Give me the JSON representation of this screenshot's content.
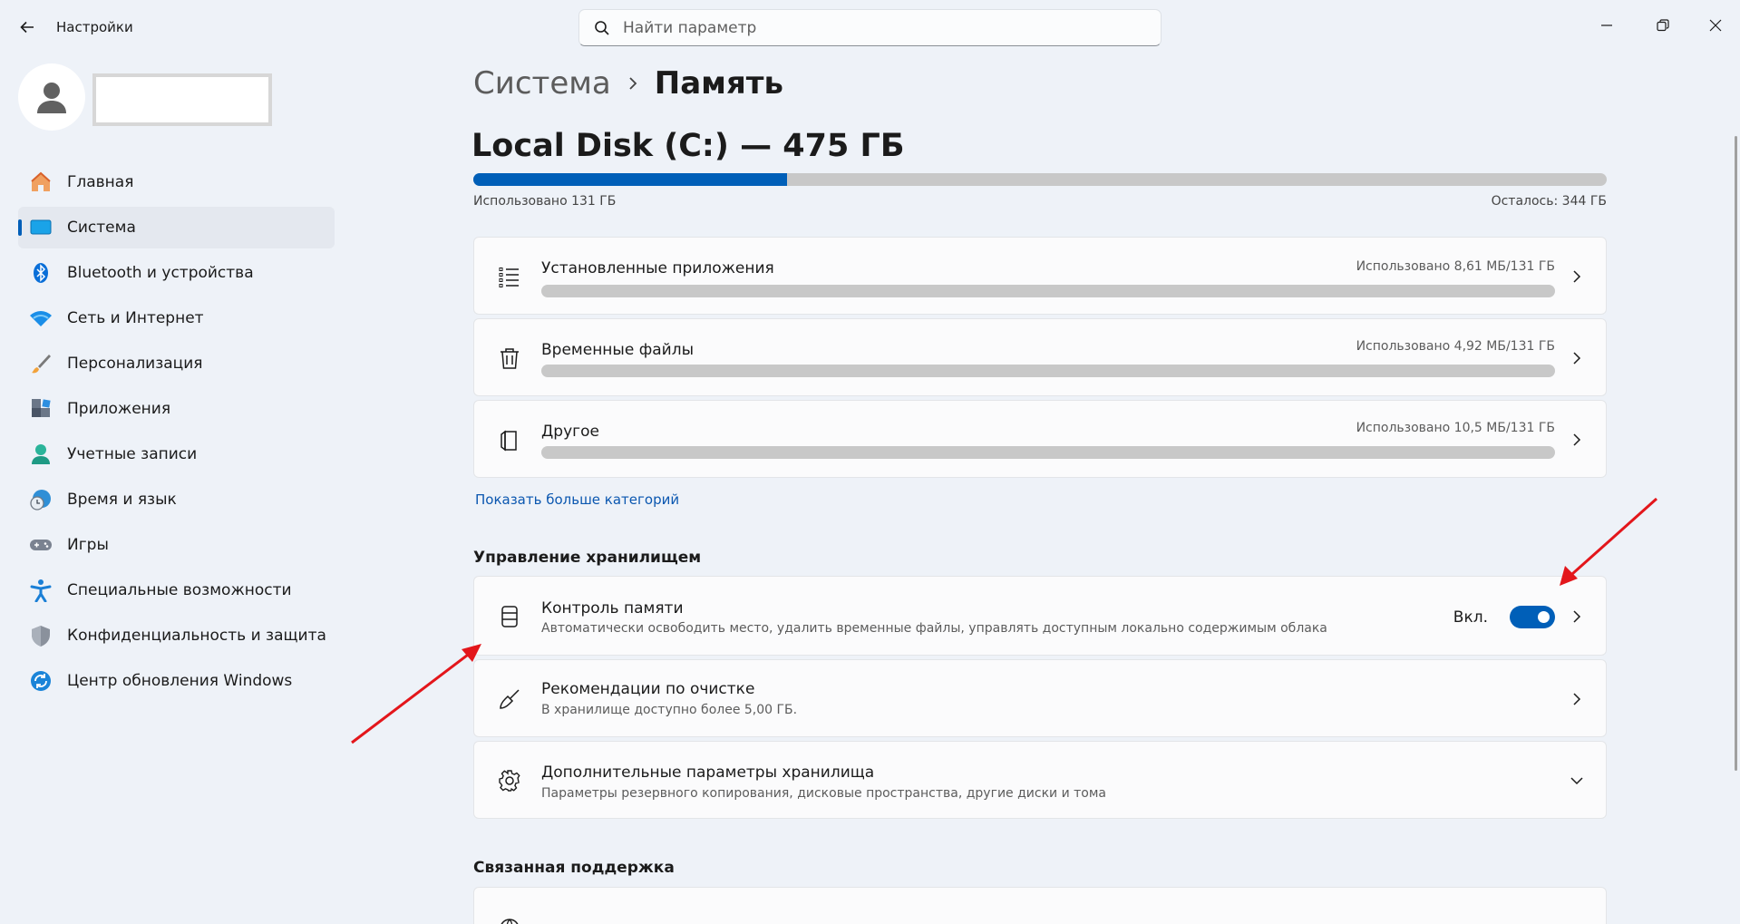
{
  "window": {
    "title": "Настройки",
    "back_icon": "back-arrow-icon",
    "controls": [
      "minimize-icon",
      "restore-icon",
      "close-icon"
    ]
  },
  "search": {
    "placeholder": "Найти параметр",
    "value": ""
  },
  "profile": {
    "name": ""
  },
  "sidebar": {
    "items": [
      {
        "label": "Главная",
        "icon": "home-icon",
        "active": false
      },
      {
        "label": "Система",
        "icon": "system-icon",
        "active": true
      },
      {
        "label": "Bluetooth и устройства",
        "icon": "bluetooth-icon",
        "active": false
      },
      {
        "label": "Сеть и Интернет",
        "icon": "wifi-icon",
        "active": false
      },
      {
        "label": "Персонализация",
        "icon": "brush-icon",
        "active": false
      },
      {
        "label": "Приложения",
        "icon": "apps-icon",
        "active": false
      },
      {
        "label": "Учетные записи",
        "icon": "account-icon",
        "active": false
      },
      {
        "label": "Время и язык",
        "icon": "clock-globe-icon",
        "active": false
      },
      {
        "label": "Игры",
        "icon": "gamepad-icon",
        "active": false
      },
      {
        "label": "Специальные возможности",
        "icon": "accessibility-icon",
        "active": false
      },
      {
        "label": "Конфиденциальность и защита",
        "icon": "shield-icon",
        "active": false
      },
      {
        "label": "Центр обновления Windows",
        "icon": "update-icon",
        "active": false
      }
    ]
  },
  "breadcrumb": {
    "parent": "Система",
    "current": "Память"
  },
  "disk": {
    "title": "Local Disk (C:) — 475 ГБ",
    "used_label": "Использовано 131 ГБ",
    "free_label": "Осталось: 344 ГБ",
    "used_fraction": 0.277
  },
  "categories": [
    {
      "title": "Установленные приложения",
      "usage": "Использовано 8,61 МБ/131 ГБ",
      "icon": "list-icon",
      "fraction": 0.0
    },
    {
      "title": "Временные файлы",
      "usage": "Использовано 4,92 МБ/131 ГБ",
      "icon": "trash-icon",
      "fraction": 0.0
    },
    {
      "title": "Другое",
      "usage": "Использовано 10,5 МБ/131 ГБ",
      "icon": "document-icon",
      "fraction": 0.0
    }
  ],
  "show_more": "Показать больше категорий",
  "storage_management": {
    "heading": "Управление хранилищем",
    "items": [
      {
        "title": "Контроль памяти",
        "subtitle": "Автоматически освободить место, удалить временные файлы, управлять доступным локально содержимым облака",
        "icon": "storage-sense-icon",
        "toggle_label": "Вкл.",
        "toggle_on": true
      },
      {
        "title": "Рекомендации по очистке",
        "subtitle": "В хранилище доступно более 5,00 ГБ.",
        "icon": "broom-icon"
      },
      {
        "title": "Дополнительные параметры хранилища",
        "subtitle": "Параметры резервного копирования, дисковые пространства, другие диски и тома",
        "icon": "gear-icon"
      }
    ]
  },
  "related_support": {
    "heading": "Связанная поддержка"
  },
  "colors": {
    "accent": "#005fb8",
    "annotation_arrow": "#e3161b"
  }
}
